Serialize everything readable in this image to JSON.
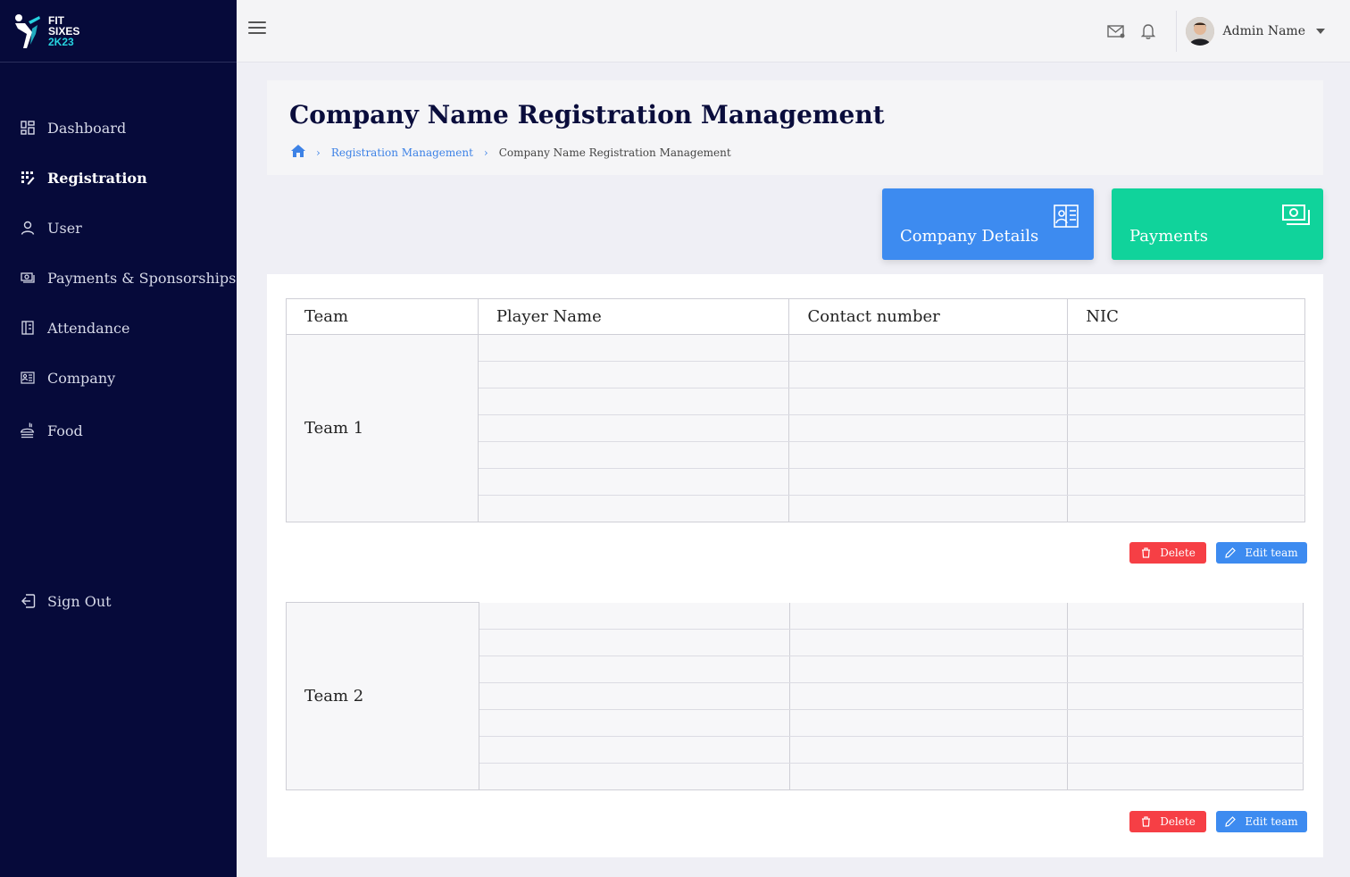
{
  "brand": {
    "line1": "FIT",
    "line2": "SIXES",
    "line3": "2K23"
  },
  "sidebar": {
    "items": [
      {
        "label": "Dashboard",
        "icon": "dashboard-icon"
      },
      {
        "label": "Registration",
        "icon": "registration-icon",
        "active": true
      },
      {
        "label": "User",
        "icon": "user-icon"
      },
      {
        "label": "Payments & Sponsorships",
        "icon": "payments-icon"
      },
      {
        "label": "Attendance",
        "icon": "attendance-icon"
      },
      {
        "label": "Company",
        "icon": "company-icon"
      },
      {
        "label": "Food",
        "icon": "food-icon"
      }
    ],
    "signout_label": "Sign Out"
  },
  "topbar": {
    "admin_name": "Admin Name"
  },
  "header": {
    "title": "Company Name Registration Management",
    "breadcrumb": [
      "Registration Management",
      "Company Name Registration Management"
    ]
  },
  "actions": {
    "company_details": "Company Details",
    "payments": "Payments"
  },
  "table": {
    "columns": [
      "Team",
      "Player Name",
      "Contact number",
      "NIC"
    ],
    "teams": [
      {
        "name": "Team 1",
        "rows": 7
      },
      {
        "name": "Team 2",
        "rows": 7
      }
    ]
  },
  "buttons": {
    "delete": "Delete",
    "edit": "Edit team"
  },
  "colors": {
    "sidebar_bg": "#060a3a",
    "accent_blue": "#3d8bf0",
    "accent_green": "#10d39b",
    "danger": "#f63f45"
  }
}
